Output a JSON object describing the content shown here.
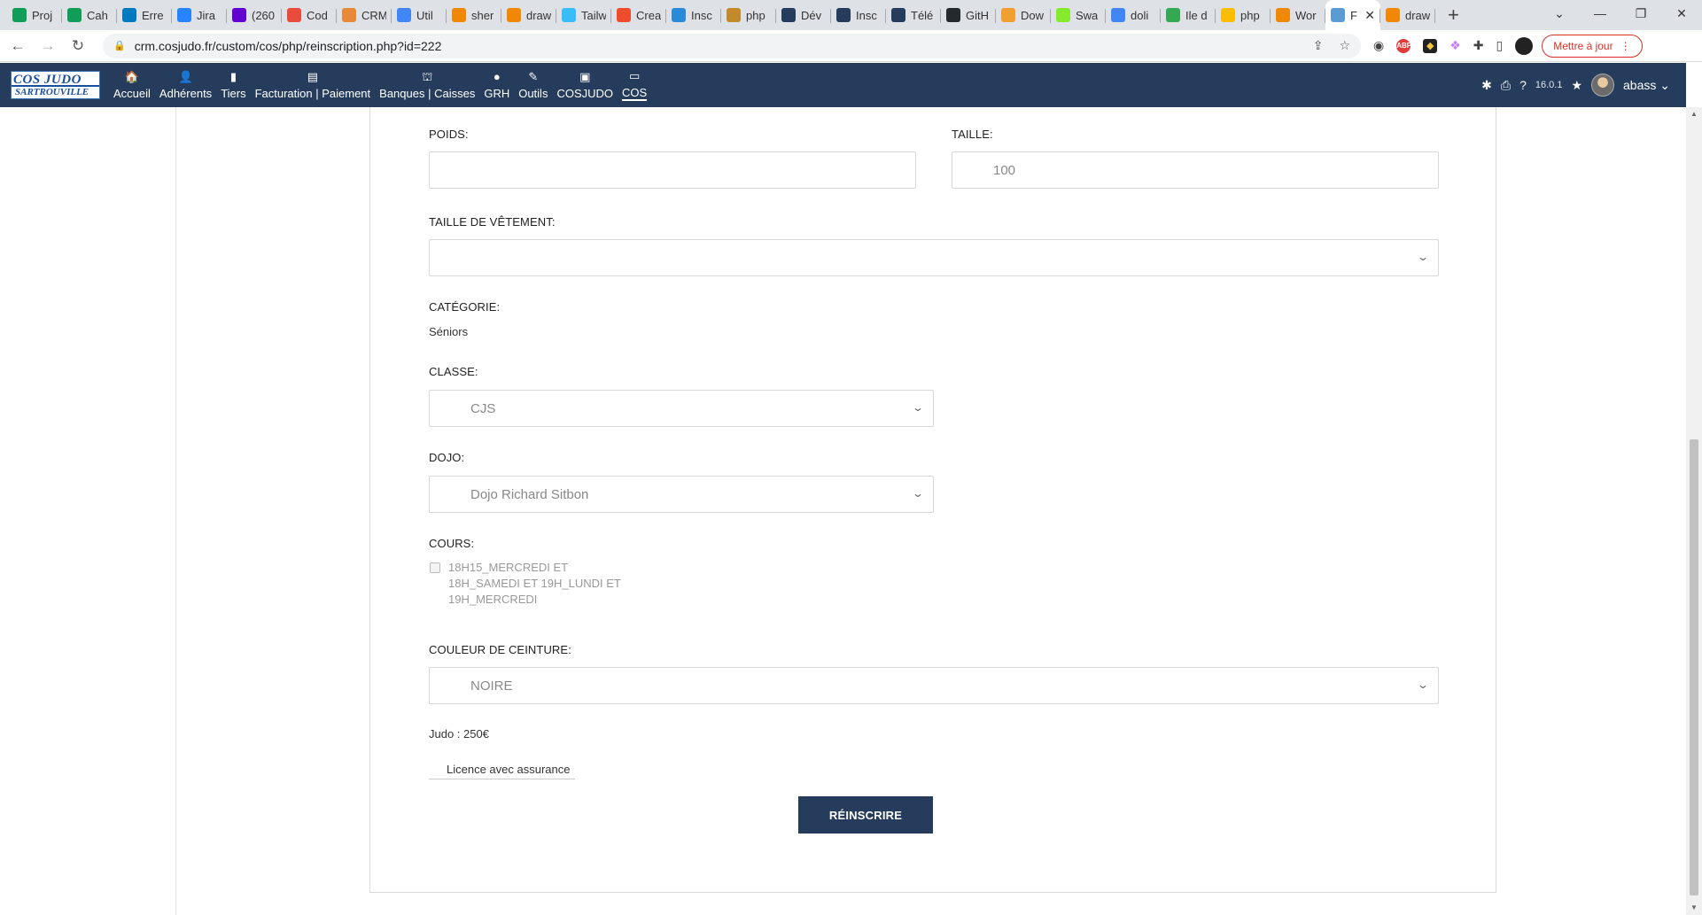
{
  "browser": {
    "tabs": [
      {
        "label": "Proj",
        "icon": "sheets-icon",
        "color": "#0f9d58"
      },
      {
        "label": "Cah",
        "icon": "sheets-icon",
        "color": "#0f9d58"
      },
      {
        "label": "Erre",
        "icon": "trello-icon",
        "color": "#0079bf"
      },
      {
        "label": "Jira",
        "icon": "jira-icon",
        "color": "#2684ff"
      },
      {
        "label": "(260",
        "icon": "mail-icon",
        "color": "#6001d2"
      },
      {
        "label": "Cod",
        "icon": "codeur-icon",
        "color": "#e94b3c"
      },
      {
        "label": "CRM",
        "icon": "crm-icon",
        "color": "#e68a3a"
      },
      {
        "label": "Util",
        "icon": "google-icon",
        "color": "#4285f4"
      },
      {
        "label": "sher",
        "icon": "drawio-icon",
        "color": "#f08705"
      },
      {
        "label": "draw",
        "icon": "drawio-icon",
        "color": "#f08705"
      },
      {
        "label": "Tailw",
        "icon": "tailwind-icon",
        "color": "#38bdf8"
      },
      {
        "label": "Crea",
        "icon": "create-icon",
        "color": "#ee4d2d"
      },
      {
        "label": "Insc",
        "icon": "pen-icon",
        "color": "#2b8ad8"
      },
      {
        "label": "php",
        "icon": "php-icon",
        "color": "#c28a2b"
      },
      {
        "label": "Dév",
        "icon": "dolibarr-icon",
        "color": "#263c5c"
      },
      {
        "label": "Insc",
        "icon": "dolibarr-icon",
        "color": "#263c5c"
      },
      {
        "label": "Télé",
        "icon": "dolibarr-icon",
        "color": "#263c5c"
      },
      {
        "label": "GitH",
        "icon": "github-icon",
        "color": "#24292e"
      },
      {
        "label": "Dow",
        "icon": "download-icon",
        "color": "#f0a030"
      },
      {
        "label": "Swa",
        "icon": "swagger-icon",
        "color": "#85ea2d"
      },
      {
        "label": "doli",
        "icon": "google-icon",
        "color": "#4285f4"
      },
      {
        "label": "Ile d",
        "icon": "maps-icon",
        "color": "#34a853"
      },
      {
        "label": "php",
        "icon": "drive-icon",
        "color": "#fbbc04"
      },
      {
        "label": "Wor",
        "icon": "drawio-icon",
        "color": "#f08705"
      },
      {
        "label": "F",
        "icon": "page-icon",
        "color": "#5a9bd4",
        "active": true
      },
      {
        "label": "draw",
        "icon": "drawio-icon",
        "color": "#f08705"
      }
    ],
    "new_tab": "+",
    "url": "crm.cosjudo.fr/custom/cos/php/reinscription.php?id=222",
    "update_button": "Mettre à jour"
  },
  "app": {
    "logo_line1": "COS JUDO",
    "logo_line2": "SARTROUVILLE",
    "menu": [
      {
        "label": "Accueil",
        "icon": "home-icon",
        "glyph": "🏠"
      },
      {
        "label": "Adhérents",
        "icon": "user-icon",
        "glyph": "👤"
      },
      {
        "label": "Tiers",
        "icon": "building-icon",
        "glyph": "▮"
      },
      {
        "label": "Facturation | Paiement",
        "icon": "invoice-icon",
        "glyph": "▤"
      },
      {
        "label": "Banques | Caisses",
        "icon": "bank-icon",
        "glyph": "⛫"
      },
      {
        "label": "GRH",
        "icon": "person-icon",
        "glyph": "●"
      },
      {
        "label": "Outils",
        "icon": "wrench-icon",
        "glyph": "✎"
      },
      {
        "label": "COSJUDO",
        "icon": "external-icon",
        "glyph": "▣"
      },
      {
        "label": "COS",
        "icon": "note-icon",
        "glyph": "▭",
        "selected": true
      }
    ],
    "version": "16.0.1",
    "user": "abass"
  },
  "form": {
    "poids_label": "POIDS:",
    "poids_value": "",
    "taille_label": "TAILLE:",
    "taille_value": "100",
    "taille_vetement_label": "TAILLE DE VÊTEMENT:",
    "taille_vetement_value": "",
    "categorie_label": "CATÉGORIE:",
    "categorie_value": "Séniors",
    "classe_label": "CLASSE:",
    "classe_value": "CJS",
    "dojo_label": "DOJO:",
    "dojo_value": "Dojo Richard Sitbon",
    "cours_label": "COURS:",
    "cours_line1": "18H15_MERCREDI ET",
    "cours_line2": "18H_SAMEDI ET 19H_LUNDI ET",
    "cours_line3": "19H_MERCREDI",
    "ceinture_label": "COULEUR DE CEINTURE:",
    "ceinture_value": "NOIRE",
    "tarif": "Judo : 250€",
    "licence": "Licence avec assurance",
    "submit_label": "RÉINSCRIRE"
  }
}
